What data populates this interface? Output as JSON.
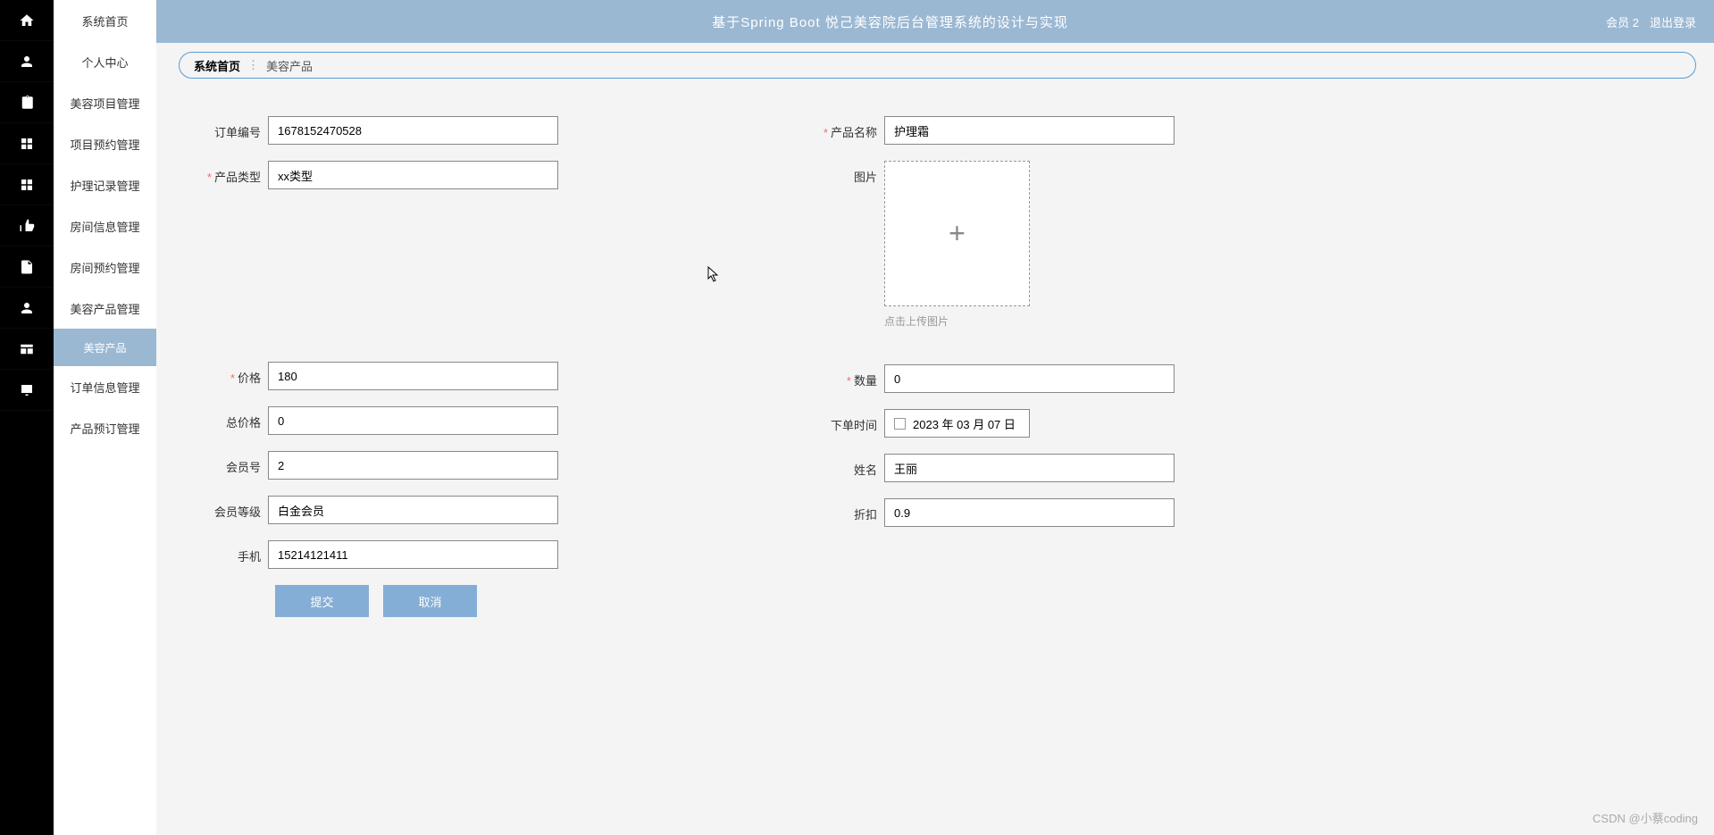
{
  "header": {
    "title": "基于Spring Boot 悦己美容院后台管理系统的设计与实现",
    "user": "会员 2",
    "logout": "退出登录"
  },
  "sidebar": {
    "items": [
      {
        "label": "系统首页"
      },
      {
        "label": "个人中心"
      },
      {
        "label": "美容项目管理"
      },
      {
        "label": "项目预约管理"
      },
      {
        "label": "护理记录管理"
      },
      {
        "label": "房间信息管理"
      },
      {
        "label": "房间预约管理"
      },
      {
        "label": "美容产品管理"
      },
      {
        "label": "订单信息管理"
      },
      {
        "label": "产品预订管理"
      }
    ],
    "sub": "美容产品"
  },
  "breadcrumb": {
    "home": "系统首页",
    "current": "美容产品"
  },
  "form": {
    "order_no_label": "订单编号",
    "order_no": "1678152470528",
    "product_name_label": "产品名称",
    "product_name": "护理霜",
    "product_type_label": "产品类型",
    "product_type": "xx类型",
    "image_label": "图片",
    "upload_tip": "点击上传图片",
    "price_label": "价格",
    "price": "180",
    "quantity_label": "数量",
    "quantity": "0",
    "total_label": "总价格",
    "total": "0",
    "order_time_label": "下单时间",
    "order_time": "2023 年 03 月 07 日",
    "member_no_label": "会员号",
    "member_no": "2",
    "name_label": "姓名",
    "name": "王丽",
    "member_level_label": "会员等级",
    "member_level": "白金会员",
    "discount_label": "折扣",
    "discount": "0.9",
    "phone_label": "手机",
    "phone": "15214121411"
  },
  "buttons": {
    "submit": "提交",
    "cancel": "取消"
  },
  "watermark": "CSDN @小蔡coding"
}
